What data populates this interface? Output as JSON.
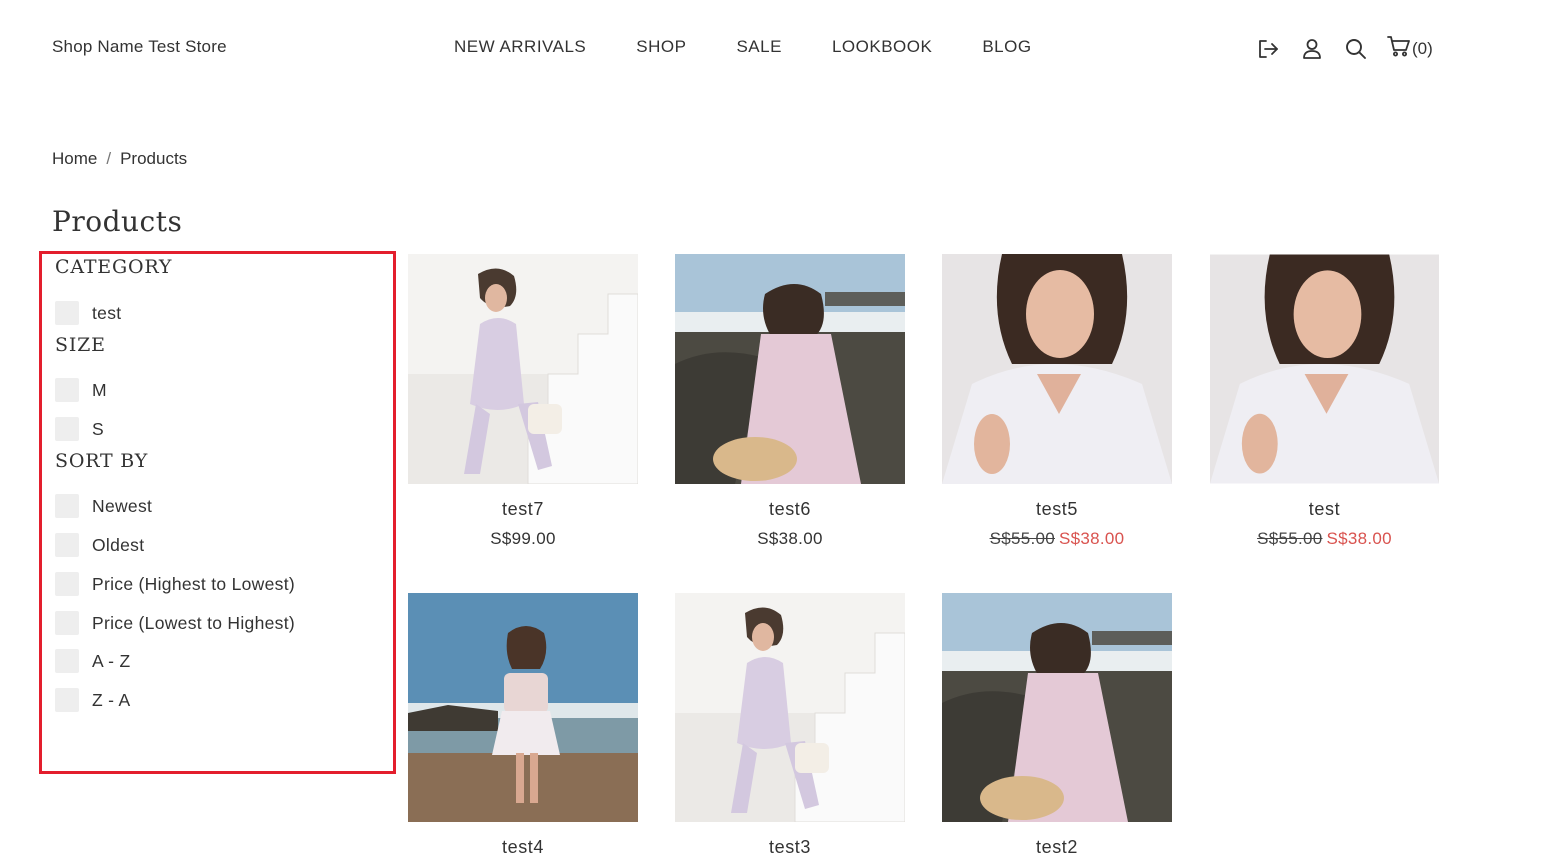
{
  "header": {
    "store_name": "Shop Name Test Store",
    "nav": [
      "NEW ARRIVALS",
      "SHOP",
      "SALE",
      "LOOKBOOK",
      "BLOG"
    ],
    "icons": [
      "logout-icon",
      "user-icon",
      "search-icon",
      "cart-icon"
    ],
    "cart_count": "(0)"
  },
  "breadcrumb": {
    "home": "Home",
    "separator": "/",
    "current": "Products"
  },
  "page_title": "Products",
  "filters": {
    "category": {
      "heading": "CATEGORY",
      "options": [
        "test"
      ]
    },
    "size": {
      "heading": "SIZE",
      "options": [
        "M",
        "S"
      ]
    },
    "sort": {
      "heading": "SORT BY",
      "options": [
        "Newest",
        "Oldest",
        "Price (Highest to Lowest)",
        "Price (Lowest to Highest)",
        "A - Z",
        "Z - A"
      ]
    },
    "highlight_color": "#e31e2d"
  },
  "products": [
    {
      "name": "test7",
      "price": "S$99.00",
      "old_price": "",
      "sale_price": ""
    },
    {
      "name": "test6",
      "price": "S$38.00",
      "old_price": "",
      "sale_price": ""
    },
    {
      "name": "test5",
      "price": "",
      "old_price": "S$55.00",
      "sale_price": "S$38.00"
    },
    {
      "name": "test",
      "price": "",
      "old_price": "S$55.00",
      "sale_price": "S$38.00"
    },
    {
      "name": "test4"
    },
    {
      "name": "test3"
    },
    {
      "name": "test2"
    }
  ],
  "colors": {
    "sale": "#d9534f",
    "text": "#333333",
    "checkbox": "#eeeeee"
  }
}
